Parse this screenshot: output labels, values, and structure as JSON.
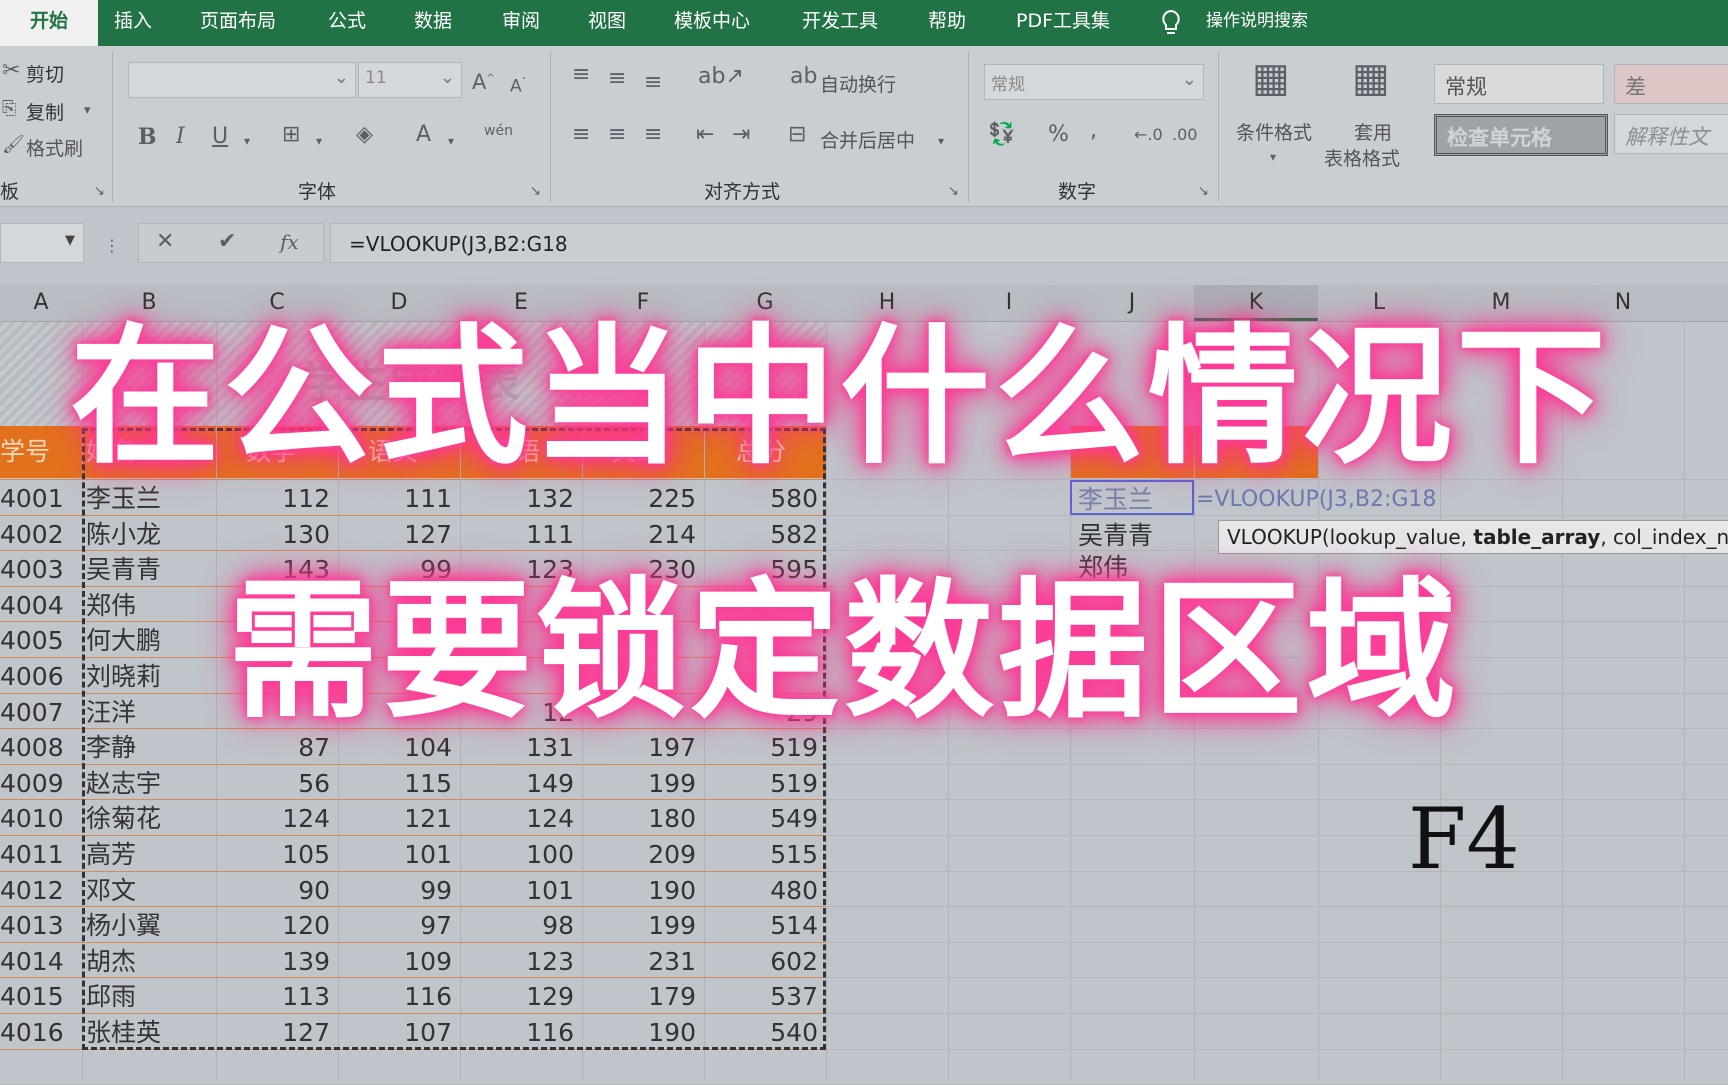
{
  "ribbon_tabs": [
    {
      "label": "开始",
      "active": true
    },
    {
      "label": "插入"
    },
    {
      "label": "页面布局"
    },
    {
      "label": "公式"
    },
    {
      "label": "数据"
    },
    {
      "label": "审阅"
    },
    {
      "label": "视图"
    },
    {
      "label": "模板中心"
    },
    {
      "label": "开发工具"
    },
    {
      "label": "帮助"
    },
    {
      "label": "PDF工具集"
    }
  ],
  "tell_me": "操作说明搜索",
  "clipboard": {
    "cut": "剪切",
    "copy": "复制",
    "format_painter": "格式刷",
    "group_label": "板"
  },
  "font": {
    "name": "",
    "size": "11",
    "group_label": "字体",
    "bold": "B",
    "italic": "I",
    "underline": "U",
    "color_a": "A",
    "wen": "wén"
  },
  "alignment": {
    "wrap": "自动换行",
    "merge": "合并后居中",
    "group_label": "对齐方式"
  },
  "number": {
    "format": "常规",
    "group_label": "数字",
    "percent": "%",
    "comma": ","
  },
  "styles": {
    "conditional": "条件格式",
    "table_format_1": "套用",
    "table_format_2": "表格格式",
    "normal": "常规",
    "bad": "差",
    "check_cell": "检查单元格",
    "explanatory": "解释性文"
  },
  "formula_bar": {
    "formula": "=VLOOKUP(J3,B2:G18",
    "fx": "fx"
  },
  "columns": [
    "A",
    "B",
    "C",
    "D",
    "E",
    "F",
    "G",
    "H",
    "I",
    "J",
    "K",
    "L",
    "M",
    "N"
  ],
  "table": {
    "title_text": "学生成绩表",
    "headers": [
      "学号",
      "姓名",
      "数学",
      "语文",
      "英语",
      "文综",
      "总分"
    ],
    "rows": [
      [
        "4001",
        "李玉兰",
        "112",
        "111",
        "132",
        "225",
        "580"
      ],
      [
        "4002",
        "陈小龙",
        "130",
        "127",
        "111",
        "214",
        "582"
      ],
      [
        "4003",
        "吴青青",
        "143",
        "99",
        "123",
        "230",
        "595"
      ],
      [
        "4004",
        "郑伟",
        "",
        "",
        "",
        "",
        ""
      ],
      [
        "4005",
        "何大鹏",
        "",
        "",
        "",
        "",
        ""
      ],
      [
        "4006",
        "刘晓莉",
        "",
        "",
        "",
        "",
        ""
      ],
      [
        "4007",
        "汪洋",
        "",
        "",
        "12",
        "",
        "29"
      ],
      [
        "4008",
        "李静",
        "87",
        "104",
        "131",
        "197",
        "519"
      ],
      [
        "4009",
        "赵志宇",
        "56",
        "115",
        "149",
        "199",
        "519"
      ],
      [
        "4010",
        "徐菊花",
        "124",
        "121",
        "124",
        "180",
        "549"
      ],
      [
        "4011",
        "高芳",
        "105",
        "101",
        "100",
        "209",
        "515"
      ],
      [
        "4012",
        "邓文",
        "90",
        "99",
        "101",
        "190",
        "480"
      ],
      [
        "4013",
        "杨小翼",
        "120",
        "97",
        "98",
        "199",
        "514"
      ],
      [
        "4014",
        "胡杰",
        "139",
        "109",
        "123",
        "231",
        "602"
      ],
      [
        "4015",
        "邱雨",
        "113",
        "116",
        "129",
        "179",
        "537"
      ],
      [
        "4016",
        "张桂英",
        "127",
        "107",
        "116",
        "190",
        "540"
      ]
    ]
  },
  "lookup": {
    "names": [
      "李玉兰",
      "吴青青",
      "郑伟"
    ],
    "formula": "=VLOOKUP(J3,B2:G18",
    "tooltip_pre": "VLOOKUP(lookup_value, ",
    "tooltip_bold": "table_array",
    "tooltip_post": ", col_index_nu"
  },
  "f4_text": "F4",
  "overlay": {
    "line1": "在公式当中什么情况下",
    "line2": "需要锁定数据区域"
  },
  "colors": {
    "accent": "#217346",
    "header_orange": "#e2711d",
    "glow": "#ff2f8e"
  }
}
